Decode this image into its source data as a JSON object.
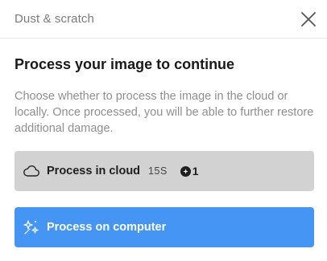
{
  "dialog": {
    "title": "Dust & scratch",
    "close_icon": "close-icon"
  },
  "main": {
    "heading": "Process your image to continue",
    "description": "Choose whether to process the image in the cloud or locally. Once processed, you will be able to further restore additional damage."
  },
  "options": {
    "cloud": {
      "label": "Process in cloud",
      "icon": "cloud-icon",
      "time": "15S",
      "credit_icon": "credit-icon",
      "credits": "1",
      "background": "#d2d2d2"
    },
    "computer": {
      "label": "Process on computer",
      "icon": "sparkle-icon",
      "background": "#4495f4"
    }
  }
}
